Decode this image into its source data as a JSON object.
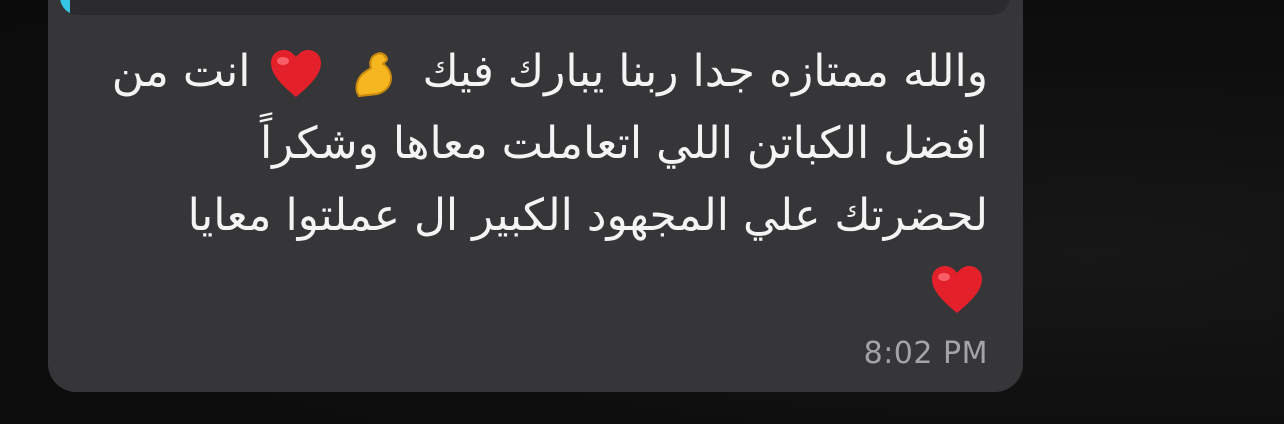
{
  "message": {
    "lines": [
      "والله ممتازه جدا ربنا يبارك فيك",
      "انت من",
      "افضل الكباتن  اللي اتعاملت معاها وشكراً",
      "لحضرتك علي المجهود الكبير ال عملتوا معايا"
    ],
    "emojis": [
      "flexed-biceps",
      "red-heart",
      "red-heart"
    ],
    "time": "8:02 PM"
  },
  "colors": {
    "bubble": "#363638",
    "quote_accent": "#35c6e6",
    "text": "#f4f4f4",
    "timestamp": "#a4a4a8"
  }
}
